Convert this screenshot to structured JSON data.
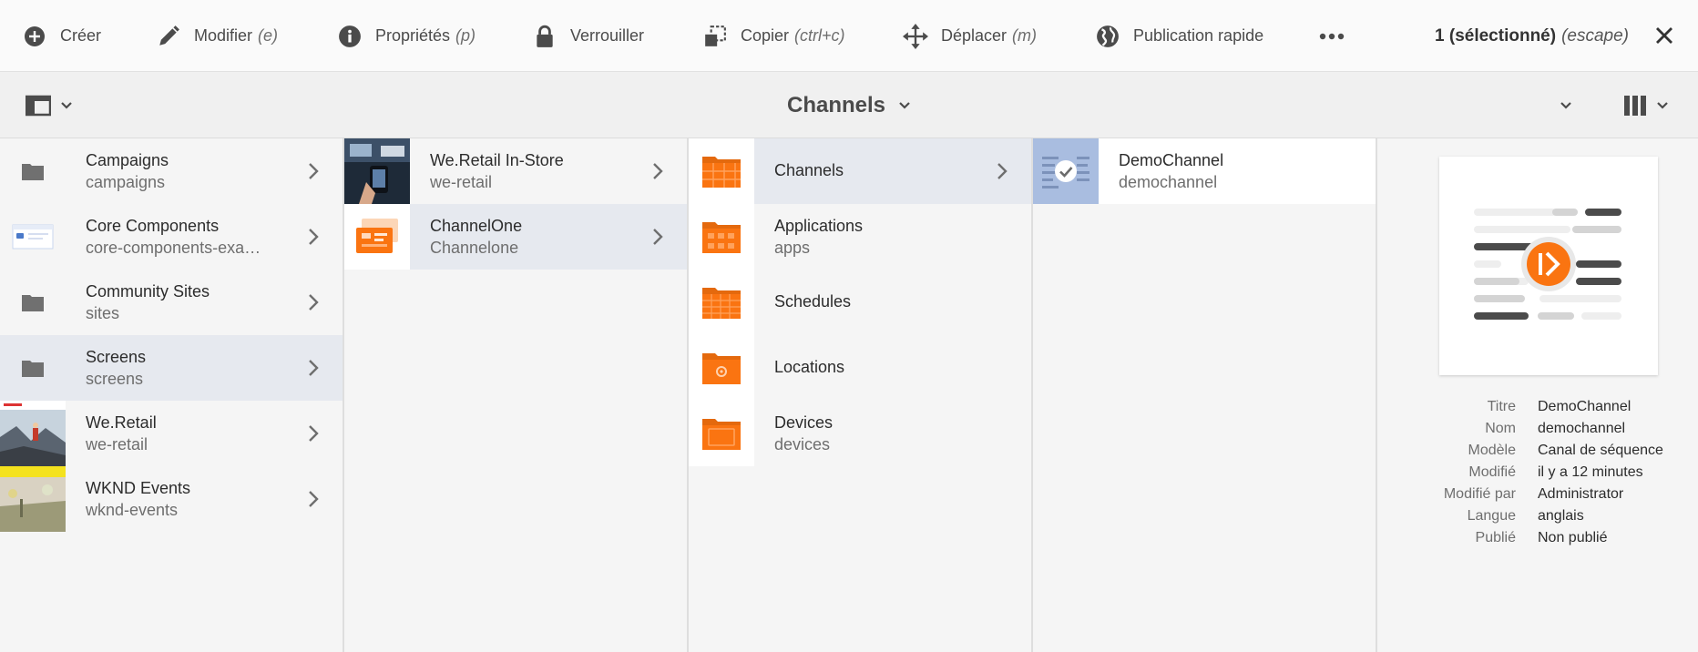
{
  "actions": [
    {
      "label": "Créer",
      "shortcut": "",
      "icon": "add-circle-icon"
    },
    {
      "label": "Modifier",
      "shortcut": "(e)",
      "icon": "pencil-icon"
    },
    {
      "label": "Propriétés",
      "shortcut": "(p)",
      "icon": "info-icon"
    },
    {
      "label": "Verrouiller",
      "shortcut": "",
      "icon": "lock-icon"
    },
    {
      "label": "Copier",
      "shortcut": "(ctrl+c)",
      "icon": "copy-icon"
    },
    {
      "label": "Déplacer",
      "shortcut": "(m)",
      "icon": "move-icon"
    },
    {
      "label": "Publication rapide",
      "shortcut": "",
      "icon": "globe-icon"
    }
  ],
  "selection": {
    "count_label": "1 (sélectionné)",
    "escape_label": "(escape)"
  },
  "header": {
    "title": "Channels"
  },
  "columns": [
    {
      "items": [
        {
          "title": "Campaigns",
          "name": "campaigns",
          "thumb": "folder",
          "active": false
        },
        {
          "title": "Core Components",
          "name": "core-components-exa…",
          "thumb": "site",
          "active": false
        },
        {
          "title": "Community Sites",
          "name": "sites",
          "thumb": "folder",
          "active": false
        },
        {
          "title": "Screens",
          "name": "screens",
          "thumb": "folder",
          "active": true
        },
        {
          "title": "We.Retail",
          "name": "we-retail",
          "thumb": "photo-mountain",
          "active": false
        },
        {
          "title": "WKND Events",
          "name": "wknd-events",
          "thumb": "photo-field",
          "active": false
        }
      ]
    },
    {
      "items": [
        {
          "title": "We.Retail In-Store",
          "name": "we-retail",
          "thumb": "photo-store",
          "active": false
        },
        {
          "title": "ChannelOne",
          "name": "Channelone",
          "thumb": "orange-card",
          "active": true
        }
      ]
    },
    {
      "items": [
        {
          "title": "Channels",
          "name": "",
          "thumb": "orange-folder-grid",
          "active": true
        },
        {
          "title": "Applications",
          "name": "apps",
          "thumb": "orange-folder-apps",
          "active": false
        },
        {
          "title": "Schedules",
          "name": "",
          "thumb": "orange-folder-cal",
          "active": false
        },
        {
          "title": "Locations",
          "name": "",
          "thumb": "orange-folder-pin",
          "active": false
        },
        {
          "title": "Devices",
          "name": "devices",
          "thumb": "orange-folder-device",
          "active": false
        }
      ]
    },
    {
      "items": [
        {
          "title": "DemoChannel",
          "name": "demochannel",
          "thumb": "checked",
          "active": false,
          "selected": true
        }
      ]
    }
  ],
  "preview": {
    "meta": [
      {
        "label": "Titre",
        "value": "DemoChannel"
      },
      {
        "label": "Nom",
        "value": "demochannel"
      },
      {
        "label": "Modèle",
        "value": "Canal de séquence"
      },
      {
        "label": "Modifié",
        "value": "il y a 12 minutes"
      },
      {
        "label": "Modifié par",
        "value": "Administrator"
      },
      {
        "label": "Langue",
        "value": "anglais"
      },
      {
        "label": "Publié",
        "value": "Non publié"
      }
    ]
  },
  "colors": {
    "accent": "#fa7411",
    "active_row": "#e6e9ef",
    "selected_thumb": "#a9bde0"
  }
}
